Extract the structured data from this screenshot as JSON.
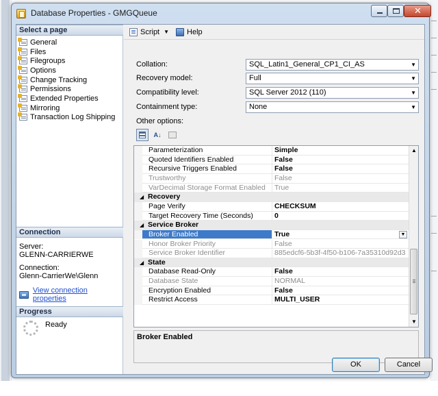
{
  "window": {
    "title": "Database Properties - GMGQueue"
  },
  "sidebar": {
    "select_header": "Select a page",
    "pages": [
      "General",
      "Files",
      "Filegroups",
      "Options",
      "Change Tracking",
      "Permissions",
      "Extended Properties",
      "Mirroring",
      "Transaction Log Shipping"
    ],
    "connection_header": "Connection",
    "server_label": "Server:",
    "server_value": "GLENN-CARRIERWE",
    "connection_label": "Connection:",
    "connection_value": "Glenn-CarrierWe\\Glenn",
    "view_connection_link": "View connection properties",
    "progress_header": "Progress",
    "progress_status": "Ready"
  },
  "toolbar": {
    "script_label": "Script",
    "help_label": "Help"
  },
  "form": {
    "collation_label": "Collation:",
    "collation_value": "SQL_Latin1_General_CP1_CI_AS",
    "recovery_label": "Recovery model:",
    "recovery_value": "Full",
    "compat_label": "Compatibility level:",
    "compat_value": "SQL Server 2012 (110)",
    "containment_label": "Containment type:",
    "containment_value": "None",
    "other_options_label": "Other options:"
  },
  "grid_rows": [
    {
      "kind": "prop",
      "name": "Parameterization",
      "value": "Simple",
      "style": "bold"
    },
    {
      "kind": "prop",
      "name": "Quoted Identifiers Enabled",
      "value": "False",
      "style": "bold"
    },
    {
      "kind": "prop",
      "name": "Recursive Triggers Enabled",
      "value": "False",
      "style": "bold"
    },
    {
      "kind": "prop",
      "name": "Trustworthy",
      "value": "False",
      "style": "gray"
    },
    {
      "kind": "prop",
      "name": "VarDecimal Storage Format Enabled",
      "value": "True",
      "style": "gray"
    },
    {
      "kind": "cat",
      "name": "Recovery"
    },
    {
      "kind": "prop",
      "name": "Page Verify",
      "value": "CHECKSUM",
      "style": "bold"
    },
    {
      "kind": "prop",
      "name": "Target Recovery Time (Seconds)",
      "value": "0",
      "style": "bold"
    },
    {
      "kind": "cat",
      "name": "Service Broker"
    },
    {
      "kind": "prop",
      "name": "Broker Enabled",
      "value": "True",
      "style": "bold-selected"
    },
    {
      "kind": "prop",
      "name": "Honor Broker Priority",
      "value": "False",
      "style": "gray"
    },
    {
      "kind": "prop",
      "name": "Service Broker Identifier",
      "value": "885edcf6-5b3f-4f50-b106-7a35310d92d3",
      "style": "gray"
    },
    {
      "kind": "cat",
      "name": "State"
    },
    {
      "kind": "prop",
      "name": "Database Read-Only",
      "value": "False",
      "style": "bold"
    },
    {
      "kind": "prop",
      "name": "Database State",
      "value": "NORMAL",
      "style": "gray"
    },
    {
      "kind": "prop",
      "name": "Encryption Enabled",
      "value": "False",
      "style": "bold"
    },
    {
      "kind": "prop",
      "name": "Restrict Access",
      "value": "MULTI_USER",
      "style": "bold"
    }
  ],
  "description": {
    "title": "Broker Enabled"
  },
  "buttons": {
    "ok": "OK",
    "cancel": "Cancel"
  }
}
